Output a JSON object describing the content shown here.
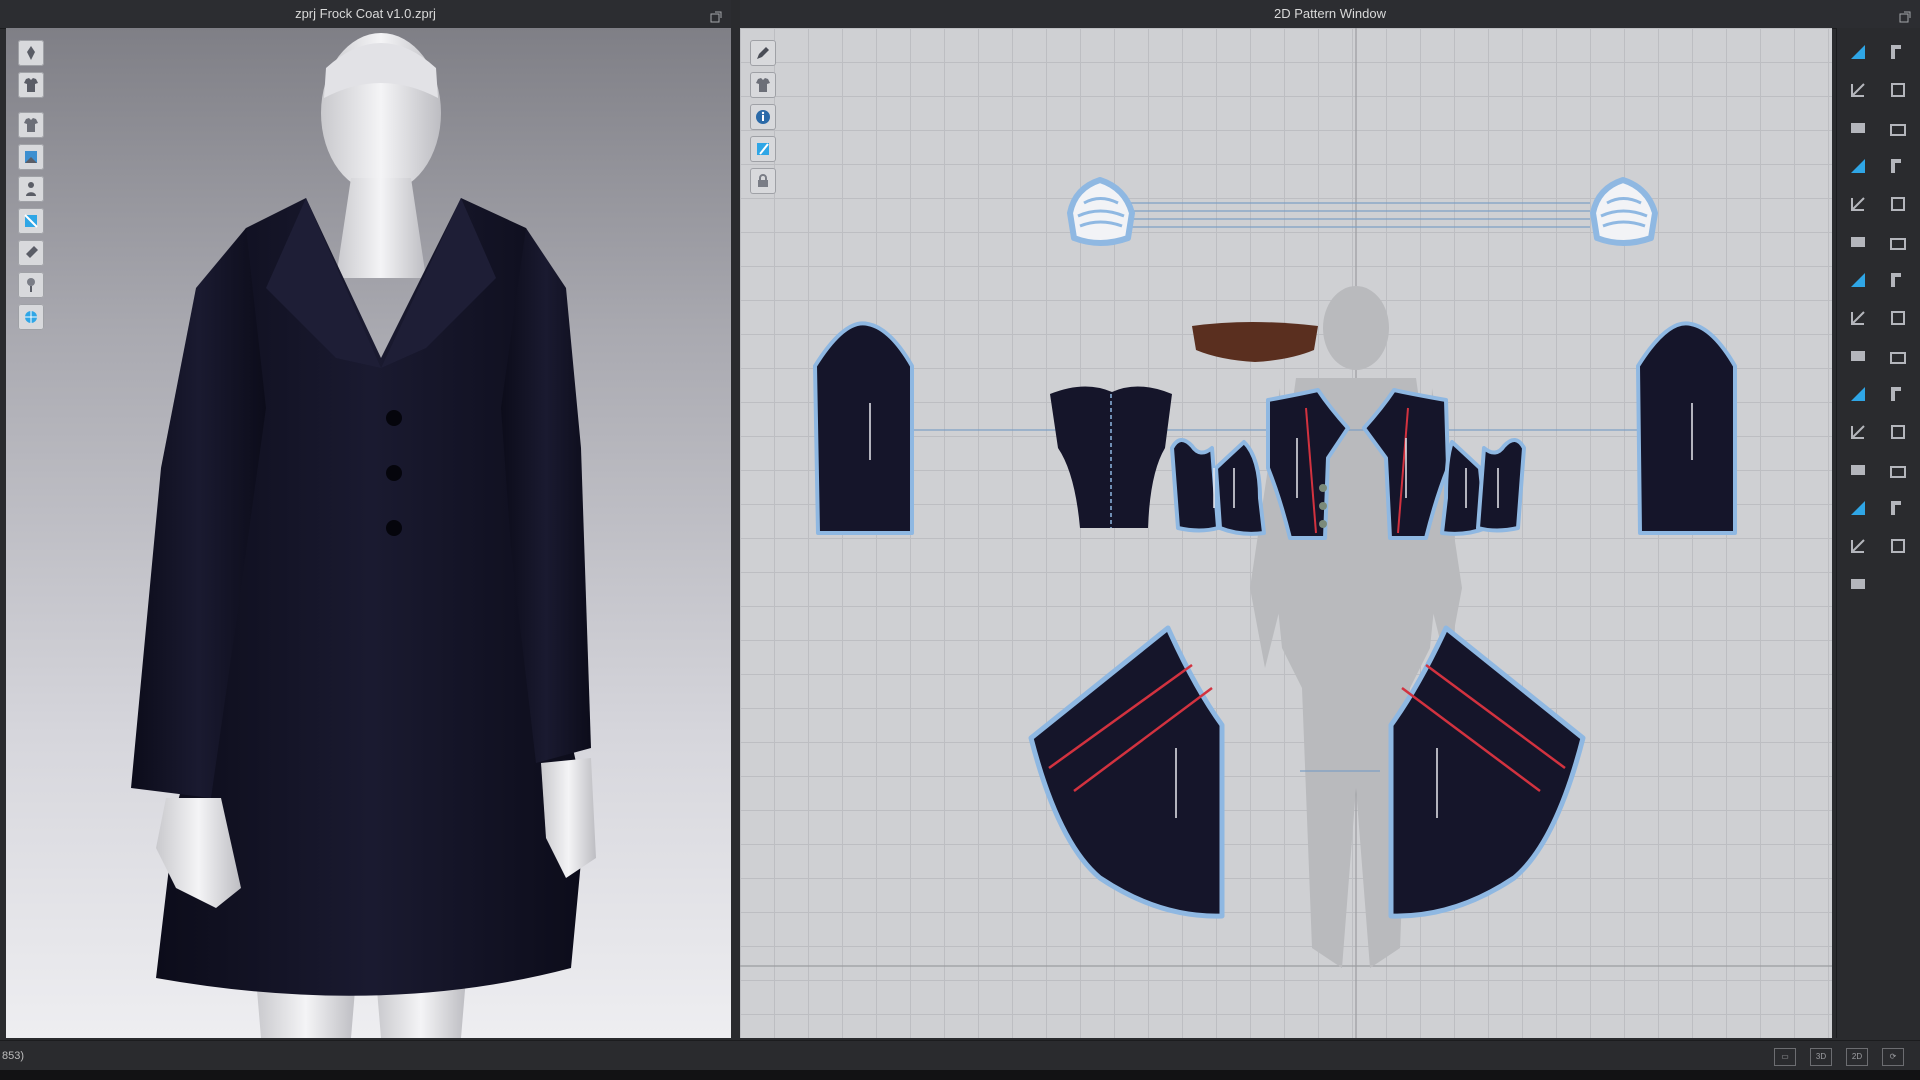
{
  "left_window": {
    "title": "zprj Frock Coat v1.0.zprj"
  },
  "right_window": {
    "title": "2D Pattern Window"
  },
  "status": {
    "text": "853)"
  },
  "left_tools": [
    "avatar-pose-icon",
    "garment-icon",
    "shirt-icon",
    "edit-texture-icon",
    "avatar-icon",
    "fold-arrange-icon",
    "brush-icon",
    "pin-icon",
    "globe-icon"
  ],
  "pattern_tools": [
    "pen-icon",
    "shirt-icon",
    "info-icon",
    "select-icon",
    "lock-icon"
  ],
  "right_tools": [
    "transform-pattern-icon",
    "segment-tool-icon",
    "edit-point-icon",
    "curve-point-icon",
    "polygon-icon",
    "internal-polygon-icon",
    "rectangle-icon",
    "internal-rectangle-icon",
    "ellipse-icon",
    "dart-icon",
    "cut-icon",
    "trace-icon",
    "fold-icon",
    "sew-icon",
    "free-sew-icon",
    "edit-sewing-icon",
    "tack-icon",
    "seam-line-icon",
    "measure-icon",
    "ruler-icon",
    "text-icon",
    "annotation-icon",
    "text-edit-icon",
    "grading-icon",
    "grid-icon",
    "puckering-icon",
    "fabric-icon",
    "layer-icon",
    "pin-tool-icon"
  ],
  "view_modes": [
    "▭",
    "3D",
    "2D",
    "⟳"
  ],
  "colors": {
    "fabric": "#15152a",
    "outline": "#8fb8e2",
    "accent": "#2fa6e6",
    "stitch": "#d2323f",
    "belt": "#5a2f1f"
  }
}
